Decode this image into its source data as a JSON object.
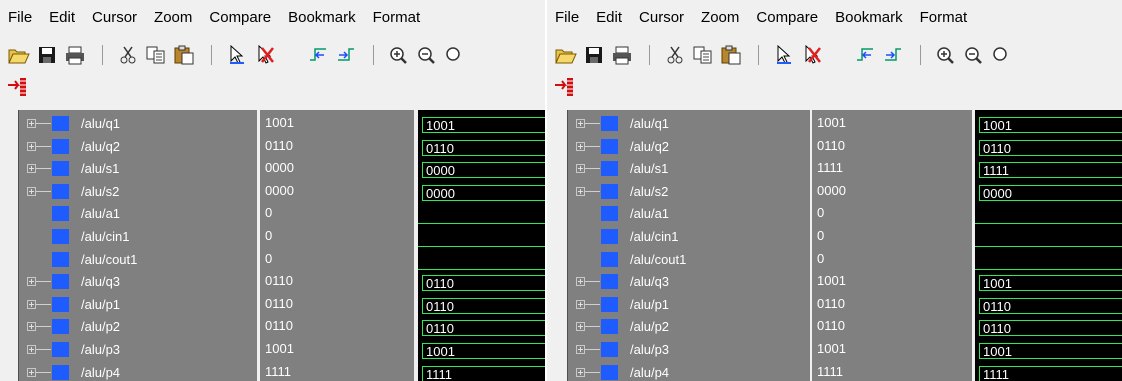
{
  "colors": {
    "wave_green": "#2ee85a",
    "signal_icon_blue": "#1e5cff",
    "list_gray": "#808080",
    "wave_background": "#000000"
  },
  "toolbar_icons": [
    "open-folder-icon",
    "save-icon",
    "print-icon",
    "cut-icon",
    "copy-icon",
    "paste-icon",
    "select-pointer-icon",
    "delete-cursor-icon",
    "previous-edge-icon",
    "next-edge-icon",
    "zoom-in-icon",
    "zoom-out-icon",
    "zoom-full-icon",
    "insert-breakpoint-icon"
  ],
  "left": {
    "menu": [
      "File",
      "Edit",
      "Cursor",
      "Zoom",
      "Compare",
      "Bookmark",
      "Format"
    ],
    "signals": [
      {
        "name": "/alu/q1",
        "value": "1001",
        "bus": true,
        "wave": "1001"
      },
      {
        "name": "/alu/q2",
        "value": "0110",
        "bus": true,
        "wave": "0110"
      },
      {
        "name": "/alu/s1",
        "value": "0000",
        "bus": true,
        "wave": "0000"
      },
      {
        "name": "/alu/s2",
        "value": "0000",
        "bus": true,
        "wave": "0000"
      },
      {
        "name": "/alu/a1",
        "value": "0",
        "bus": false,
        "wave": ""
      },
      {
        "name": "/alu/cin1",
        "value": "0",
        "bus": false,
        "wave": ""
      },
      {
        "name": "/alu/cout1",
        "value": "0",
        "bus": false,
        "wave": ""
      },
      {
        "name": "/alu/q3",
        "value": "0110",
        "bus": true,
        "wave": "0110"
      },
      {
        "name": "/alu/p1",
        "value": "0110",
        "bus": true,
        "wave": "0110"
      },
      {
        "name": "/alu/p2",
        "value": "0110",
        "bus": true,
        "wave": "0110"
      },
      {
        "name": "/alu/p3",
        "value": "1001",
        "bus": true,
        "wave": "1001"
      },
      {
        "name": "/alu/p4",
        "value": "1111",
        "bus": true,
        "wave": "1111"
      }
    ]
  },
  "right": {
    "menu": [
      "File",
      "Edit",
      "Cursor",
      "Zoom",
      "Compare",
      "Bookmark",
      "Format"
    ],
    "signals": [
      {
        "name": "/alu/q1",
        "value": "1001",
        "bus": true,
        "wave": "1001"
      },
      {
        "name": "/alu/q2",
        "value": "0110",
        "bus": true,
        "wave": "0110"
      },
      {
        "name": "/alu/s1",
        "value": "1111",
        "bus": true,
        "wave": "1111"
      },
      {
        "name": "/alu/s2",
        "value": "0000",
        "bus": true,
        "wave": "0000"
      },
      {
        "name": "/alu/a1",
        "value": "0",
        "bus": false,
        "wave": ""
      },
      {
        "name": "/alu/cin1",
        "value": "0",
        "bus": false,
        "wave": ""
      },
      {
        "name": "/alu/cout1",
        "value": "0",
        "bus": false,
        "wave": ""
      },
      {
        "name": "/alu/q3",
        "value": "1001",
        "bus": true,
        "wave": "1001"
      },
      {
        "name": "/alu/p1",
        "value": "0110",
        "bus": true,
        "wave": "0110"
      },
      {
        "name": "/alu/p2",
        "value": "0110",
        "bus": true,
        "wave": "0110"
      },
      {
        "name": "/alu/p3",
        "value": "1001",
        "bus": true,
        "wave": "1001"
      },
      {
        "name": "/alu/p4",
        "value": "1111",
        "bus": true,
        "wave": "1111"
      }
    ]
  }
}
